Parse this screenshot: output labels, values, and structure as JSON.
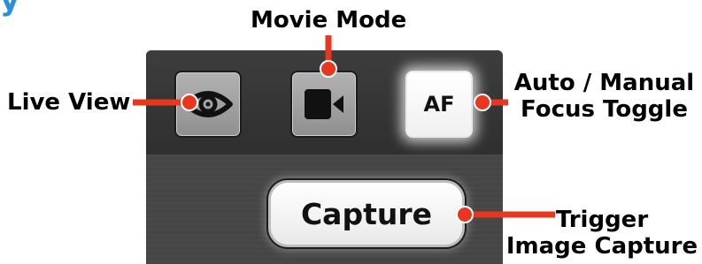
{
  "header": {
    "title_fragment": "y"
  },
  "toolbar": {
    "live_view_icon": "eye-icon",
    "movie_mode_icon": "video-camera-icon",
    "af_label": "AF"
  },
  "capture": {
    "label": "Capture"
  },
  "callouts": {
    "live_view": "Live View",
    "movie_mode": "Movie Mode",
    "af_line1": "Auto / Manual",
    "af_line2": "Focus Toggle",
    "trigger_line1": "Trigger",
    "trigger_line2": "Image Capture"
  },
  "colors": {
    "callout_line": "#e8361f",
    "panel": "#3a3a3a",
    "button_grey": "#a0a0a0",
    "title_accent": "#2b8fd6"
  }
}
